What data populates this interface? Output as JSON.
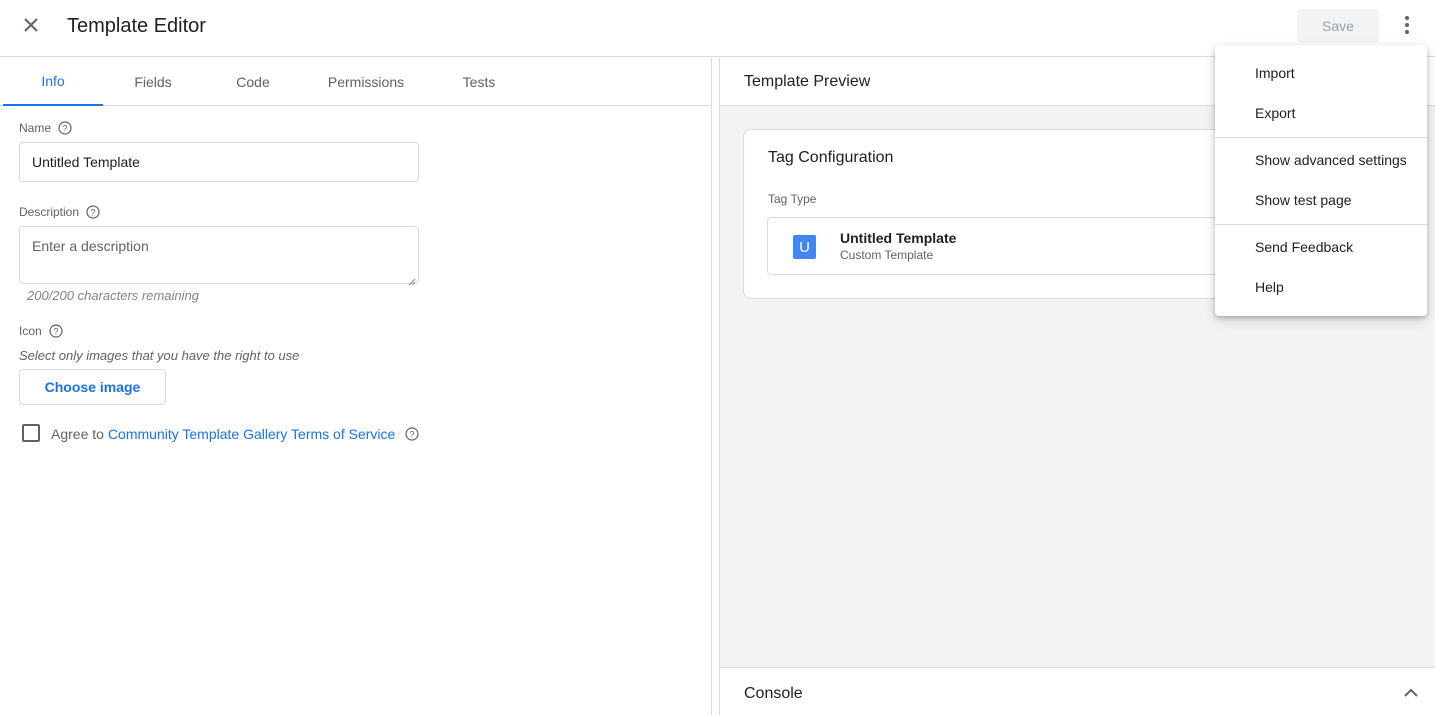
{
  "header": {
    "title": "Template Editor",
    "save_label": "Save",
    "close_icon": "close-icon",
    "more_icon": "more-vert-icon"
  },
  "tabs": [
    {
      "label": "Info",
      "active": true
    },
    {
      "label": "Fields",
      "active": false
    },
    {
      "label": "Code",
      "active": false
    },
    {
      "label": "Permissions",
      "active": false
    },
    {
      "label": "Tests",
      "active": false
    }
  ],
  "info_form": {
    "name_label": "Name",
    "name_value": "Untitled Template",
    "description_label": "Description",
    "description_placeholder": "Enter a description",
    "char_remaining": "200/200 characters remaining",
    "icon_label": "Icon",
    "icon_hint": "Select only images that you have the right to use",
    "choose_image_label": "Choose image",
    "agree_prefix": "Agree to",
    "agree_link": "Community Template Gallery Terms of Service",
    "agree_checked": false
  },
  "preview": {
    "title": "Template Preview",
    "card_title": "Tag Configuration",
    "tag_type_label": "Tag Type",
    "tag_badge": "U",
    "tag_name": "Untitled Template",
    "tag_sub": "Custom Template"
  },
  "console": {
    "title": "Console",
    "toggle_icon": "chevron-up-icon"
  },
  "menu": {
    "items": [
      "Import",
      "Export",
      "Show advanced settings",
      "Show test page",
      "Send Feedback",
      "Help"
    ]
  },
  "colors": {
    "accent": "#1a73e8",
    "badge": "#4285f4",
    "divider": "#dadce0",
    "panel_bg": "#f1f3f4"
  }
}
